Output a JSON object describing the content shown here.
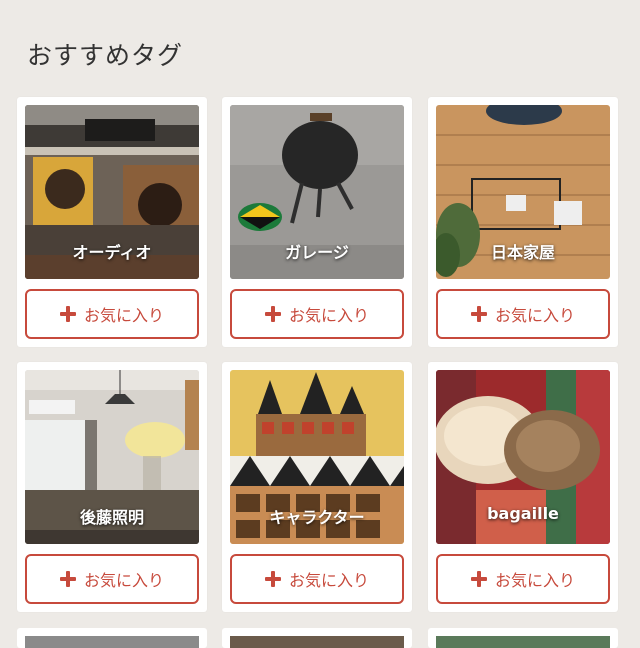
{
  "section": {
    "title": "おすすめタグ"
  },
  "tags": [
    {
      "label": "オーディオ",
      "button": "お気に入り"
    },
    {
      "label": "ガレージ",
      "button": "お気に入り"
    },
    {
      "label": "日本家屋",
      "button": "お気に入り"
    },
    {
      "label": "後藤照明",
      "button": "お気に入り"
    },
    {
      "label": "キャラクター",
      "button": "お気に入り"
    },
    {
      "label": "bagaille",
      "button": "お気に入り"
    }
  ],
  "colors": {
    "accent": "#c74a3c",
    "background": "#edeae6"
  }
}
